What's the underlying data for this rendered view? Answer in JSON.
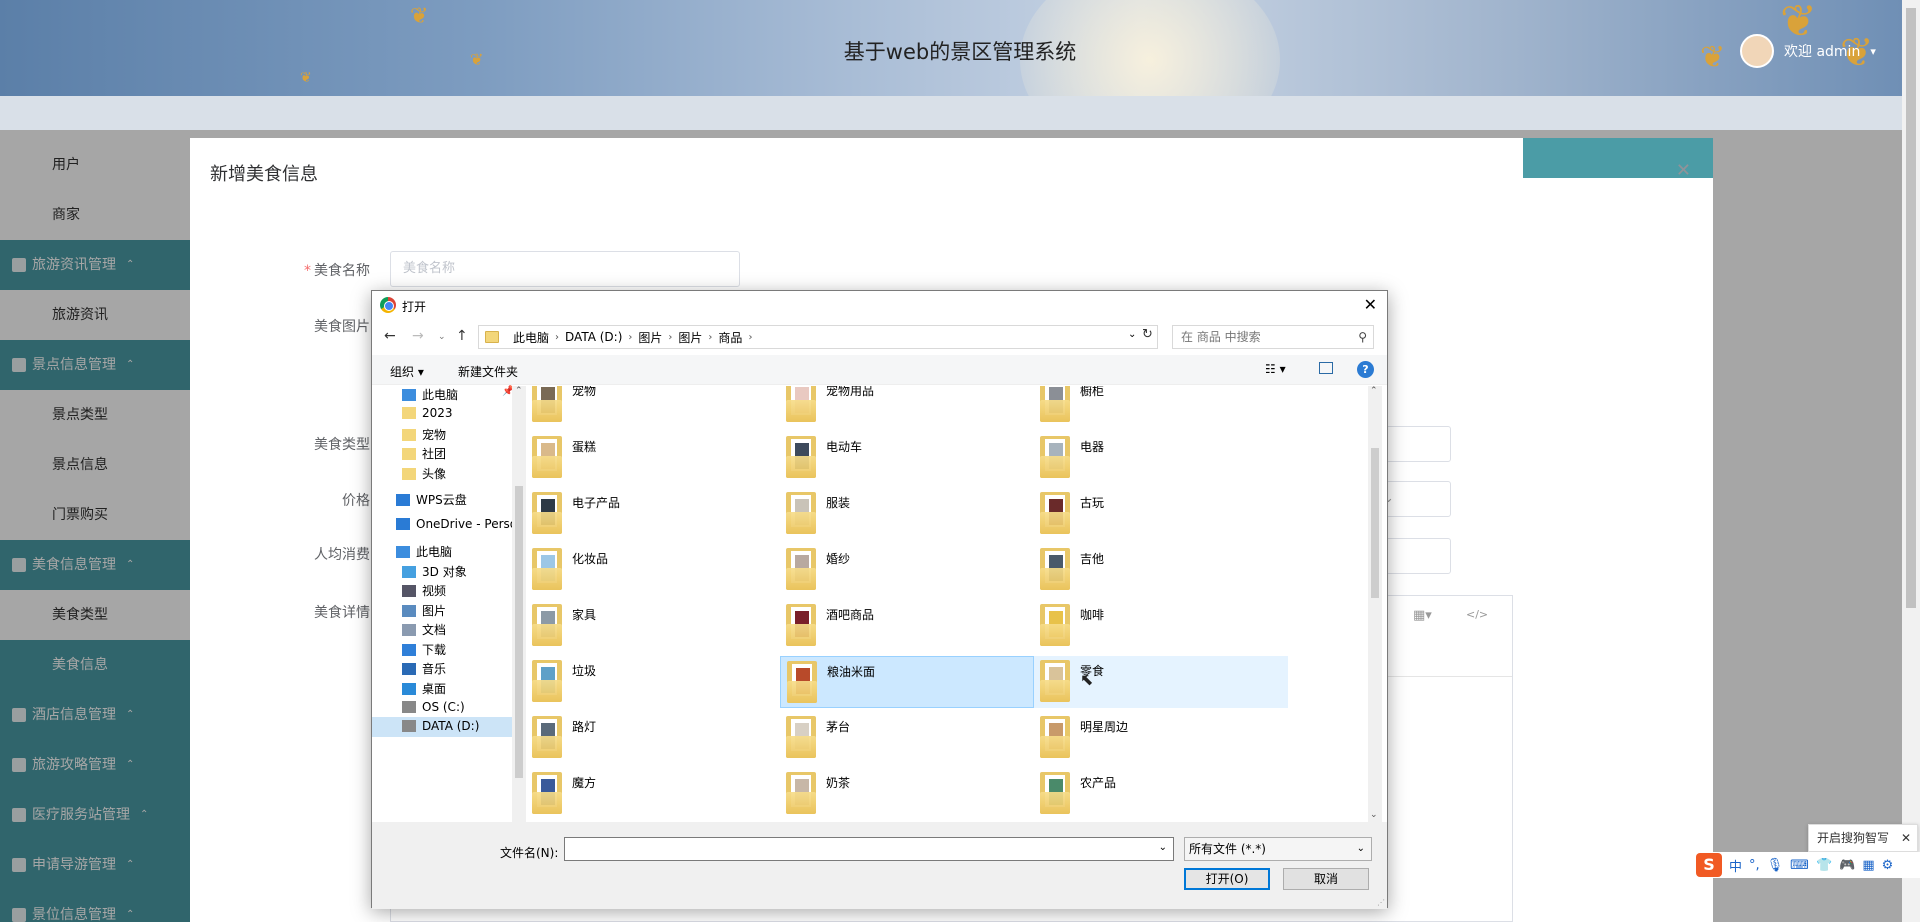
{
  "app": {
    "title": "基于web的景区管理系统",
    "welcome": "欢迎 admin"
  },
  "sidebar": {
    "items": [
      {
        "label": "用户",
        "type": "item"
      },
      {
        "label": "商家",
        "type": "item"
      },
      {
        "label": "旅游资讯管理",
        "type": "group"
      },
      {
        "label": "旅游资讯",
        "type": "item"
      },
      {
        "label": "景点信息管理",
        "type": "group"
      },
      {
        "label": "景点类型",
        "type": "item"
      },
      {
        "label": "景点信息",
        "type": "item"
      },
      {
        "label": "门票购买",
        "type": "item"
      },
      {
        "label": "美食信息管理",
        "type": "group"
      },
      {
        "label": "美食类型",
        "type": "item"
      },
      {
        "label": "美食信息",
        "type": "item",
        "active": true
      },
      {
        "label": "酒店信息管理",
        "type": "group"
      },
      {
        "label": "旅游攻略管理",
        "type": "group"
      },
      {
        "label": "医疗服务站管理",
        "type": "group"
      },
      {
        "label": "申请导游管理",
        "type": "group"
      },
      {
        "label": "景位信息管理",
        "type": "group"
      }
    ]
  },
  "modal": {
    "title": "新增美食信息",
    "fields": {
      "name_label": "美食名称",
      "name_placeholder": "美食名称",
      "image_label": "美食图片",
      "type_label": "美食类型",
      "price_label": "价格",
      "avg_label": "人均消费",
      "detail_label": "美食详情"
    }
  },
  "dialog": {
    "title": "打开",
    "breadcrumb": [
      "此电脑",
      "DATA (D:)",
      "图片",
      "图片",
      "商品"
    ],
    "search_placeholder": "在 商品 中搜索",
    "toolbar": {
      "organize": "组织 ▾",
      "new_folder": "新建文件夹"
    },
    "nav_pane": [
      {
        "label": "此电脑",
        "icon": "pc-icon",
        "indent": 1,
        "pinned": true
      },
      {
        "label": "2023",
        "icon": "folder-icon",
        "indent": 1
      },
      {
        "label": "宠物",
        "icon": "folder-icon",
        "indent": 1
      },
      {
        "label": "社团",
        "icon": "folder-icon",
        "indent": 1
      },
      {
        "label": "头像",
        "icon": "folder-icon",
        "indent": 1
      },
      {
        "label": "WPS云盘",
        "icon": "cloud-icon",
        "indent": 0
      },
      {
        "label": "OneDrive - Perso",
        "icon": "cloud-icon",
        "indent": 0
      },
      {
        "label": "此电脑",
        "icon": "pc-icon",
        "indent": 0
      },
      {
        "label": "3D 对象",
        "icon": "cube-icon",
        "indent": 1
      },
      {
        "label": "视频",
        "icon": "video-icon",
        "indent": 1
      },
      {
        "label": "图片",
        "icon": "picture-icon",
        "indent": 1
      },
      {
        "label": "文档",
        "icon": "document-icon",
        "indent": 1
      },
      {
        "label": "下载",
        "icon": "download-icon",
        "indent": 1
      },
      {
        "label": "音乐",
        "icon": "music-icon",
        "indent": 1
      },
      {
        "label": "桌面",
        "icon": "desktop-icon",
        "indent": 1
      },
      {
        "label": "OS (C:)",
        "icon": "drive-icon",
        "indent": 1
      },
      {
        "label": "DATA (D:)",
        "icon": "drive-icon",
        "indent": 1,
        "selected": true
      }
    ],
    "folders": [
      {
        "name": "宠物",
        "color": "#7a6a55"
      },
      {
        "name": "宠物用品",
        "color": "#e9c9c1"
      },
      {
        "name": "橱柜",
        "color": "#8b8f96"
      },
      {
        "name": "蛋糕",
        "color": "#d9b98a"
      },
      {
        "name": "电动车",
        "color": "#3d4a5c"
      },
      {
        "name": "电器",
        "color": "#a7b3bd"
      },
      {
        "name": "电子产品",
        "color": "#2e3a46"
      },
      {
        "name": "服装",
        "color": "#c9c3b8"
      },
      {
        "name": "古玩",
        "color": "#6a2a2a"
      },
      {
        "name": "化妆品",
        "color": "#9cc7e6"
      },
      {
        "name": "婚纱",
        "color": "#b8a9a0"
      },
      {
        "name": "吉他",
        "color": "#4a5a6a"
      },
      {
        "name": "家具",
        "color": "#8c9aa6"
      },
      {
        "name": "酒吧商品",
        "color": "#7a1f2a"
      },
      {
        "name": "咖啡",
        "color": "#e8c24a"
      },
      {
        "name": "垃圾",
        "color": "#5fa0c8"
      },
      {
        "name": "粮油米面",
        "color": "#b84a2a",
        "selected": true
      },
      {
        "name": "零食",
        "color": "#d9c39a",
        "hover": true
      },
      {
        "name": "路灯",
        "color": "#5a6a7a"
      },
      {
        "name": "茅台",
        "color": "#d8d0c4"
      },
      {
        "name": "明星周边",
        "color": "#c89a6a"
      },
      {
        "name": "魔方",
        "color": "#3a5a9a"
      },
      {
        "name": "奶茶",
        "color": "#c7b7a7"
      },
      {
        "name": "农产品",
        "color": "#4a8a6a"
      }
    ],
    "filename_label": "文件名(N):",
    "filename_value": "",
    "filetype": "所有文件 (*.*)",
    "open_button": "打开(O)",
    "cancel_button": "取消"
  },
  "ime": {
    "tip": "开启搜狗智写",
    "logo": "S",
    "mode": "中"
  },
  "colors": {
    "accent": "#4b9ca6",
    "selection": "#cce8ff",
    "dialog_primary": "#0078d7"
  }
}
